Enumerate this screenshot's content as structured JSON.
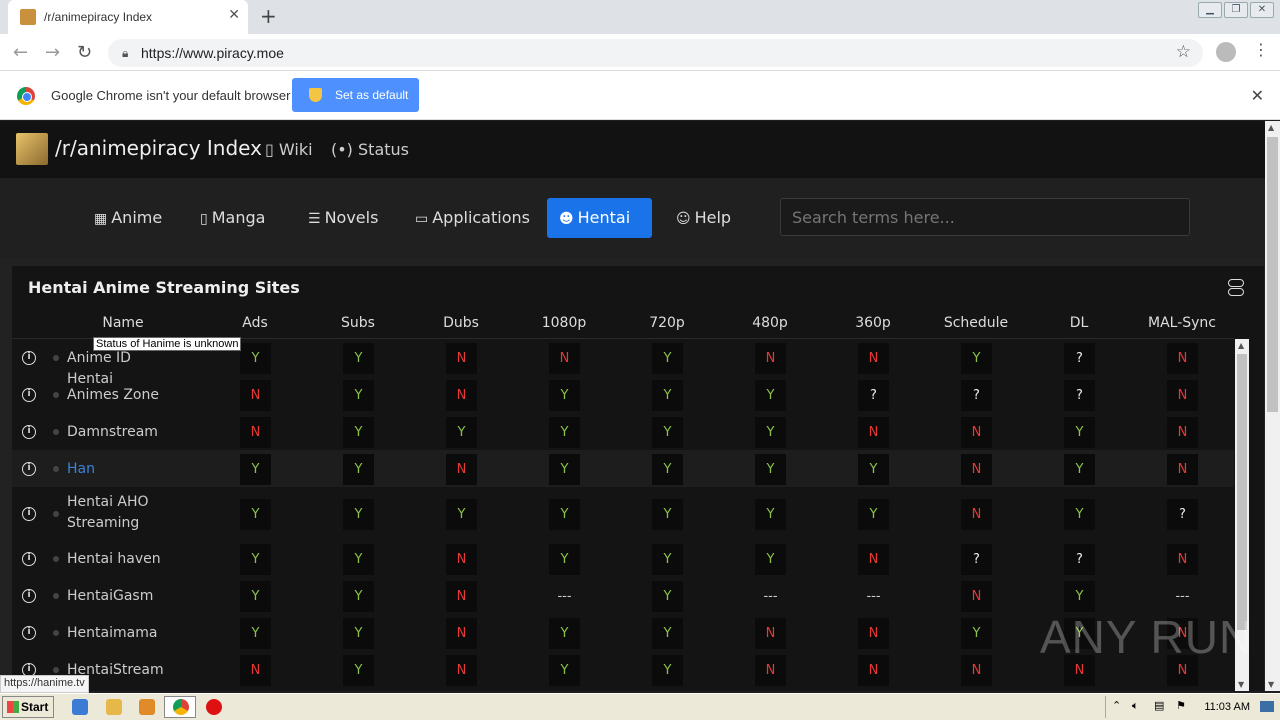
{
  "browser": {
    "tab_title": "/r/animepiracy Index",
    "new_tab": "+",
    "url": "https://www.piracy.moe",
    "infobar_text": "Google Chrome isn't your default browser",
    "set_default_label": "Set as default",
    "status_url": "https://hanime.tv"
  },
  "site": {
    "title": "/r/animepiracy Index",
    "header_links": [
      {
        "icon": "book-icon",
        "label": "Wiki"
      },
      {
        "icon": "broadcast-icon",
        "label": "Status"
      }
    ],
    "nav": [
      {
        "icon": "film-icon",
        "label": "Anime",
        "active": false
      },
      {
        "icon": "book-icon",
        "label": "Manga",
        "active": false
      },
      {
        "icon": "document-icon",
        "label": "Novels",
        "active": false
      },
      {
        "icon": "window-icon",
        "label": "Applications",
        "active": false
      },
      {
        "icon": "avatar-icon",
        "label": "Hentai",
        "active": true
      },
      {
        "icon": "mascot-icon",
        "label": "Help",
        "active": false
      }
    ],
    "search_placeholder": "Search terms here..."
  },
  "table": {
    "title": "Hentai Anime Streaming Sites",
    "columns": [
      "Name",
      "Ads",
      "Subs",
      "Dubs",
      "1080p",
      "720p",
      "480p",
      "360p",
      "Schedule",
      "DL",
      "MAL-Sync"
    ],
    "rows": [
      {
        "name": "Anime ID Hentai",
        "values": [
          "Y",
          "Y",
          "N",
          "N",
          "Y",
          "N",
          "N",
          "Y",
          "?",
          "N"
        ]
      },
      {
        "name": "Animes Zone",
        "values": [
          "N",
          "Y",
          "N",
          "Y",
          "Y",
          "Y",
          "?",
          "?",
          "?",
          "N"
        ]
      },
      {
        "name": "Damnstream",
        "values": [
          "N",
          "Y",
          "Y",
          "Y",
          "Y",
          "Y",
          "N",
          "N",
          "Y",
          "N"
        ]
      },
      {
        "name": "Han",
        "values": [
          "Y",
          "Y",
          "N",
          "Y",
          "Y",
          "Y",
          "Y",
          "N",
          "Y",
          "N"
        ],
        "link": true,
        "hover": true
      },
      {
        "name": "Hentai AHO Streaming",
        "values": [
          "Y",
          "Y",
          "Y",
          "Y",
          "Y",
          "Y",
          "Y",
          "N",
          "Y",
          "?"
        ]
      },
      {
        "name": "Hentai haven",
        "values": [
          "Y",
          "Y",
          "N",
          "Y",
          "Y",
          "Y",
          "N",
          "?",
          "?",
          "N"
        ]
      },
      {
        "name": "HentaiGasm",
        "values": [
          "Y",
          "Y",
          "N",
          "---",
          "Y",
          "---",
          "---",
          "N",
          "Y",
          "---"
        ]
      },
      {
        "name": "Hentaimama",
        "values": [
          "Y",
          "Y",
          "N",
          "Y",
          "Y",
          "N",
          "N",
          "Y",
          "Y",
          "N"
        ]
      },
      {
        "name": "HentaiStream",
        "values": [
          "N",
          "Y",
          "N",
          "Y",
          "Y",
          "N",
          "N",
          "N",
          "N",
          "N"
        ]
      }
    ],
    "tooltip": "Status of Hanime is unknown"
  },
  "watermark": "ANY RUN",
  "taskbar": {
    "start_label": "Start",
    "clock": "11:03 AM"
  },
  "colors": {
    "yes": "#8bc34a",
    "no": "#e53935",
    "active_nav": "#1a73e8"
  }
}
